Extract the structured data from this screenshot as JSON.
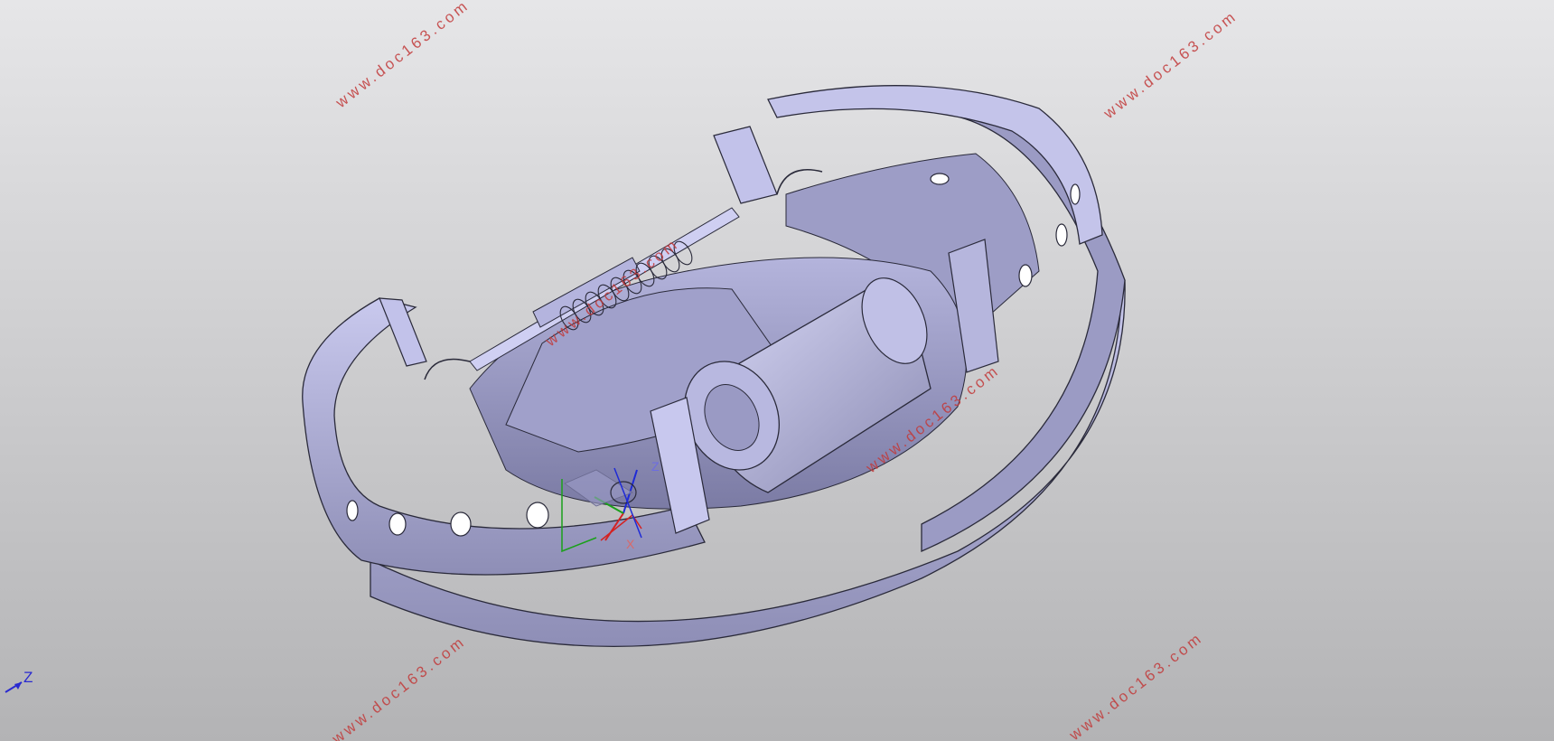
{
  "viewport": {
    "background_top": "#e6e6e8",
    "background_bottom": "#b3b3b5",
    "model_color": "#a9a9cf"
  },
  "watermarks": [
    {
      "text": "www.doc163.com"
    },
    {
      "text": "www.doc163.com"
    },
    {
      "text": "www.doc163.com"
    },
    {
      "text": "www.doc163.com"
    },
    {
      "text": "www.doc163.com"
    },
    {
      "text": "www.doc163.com"
    }
  ],
  "compass": {
    "z_label": "Z",
    "x_label": "X"
  },
  "axis_indicator": {
    "label": "Z"
  }
}
